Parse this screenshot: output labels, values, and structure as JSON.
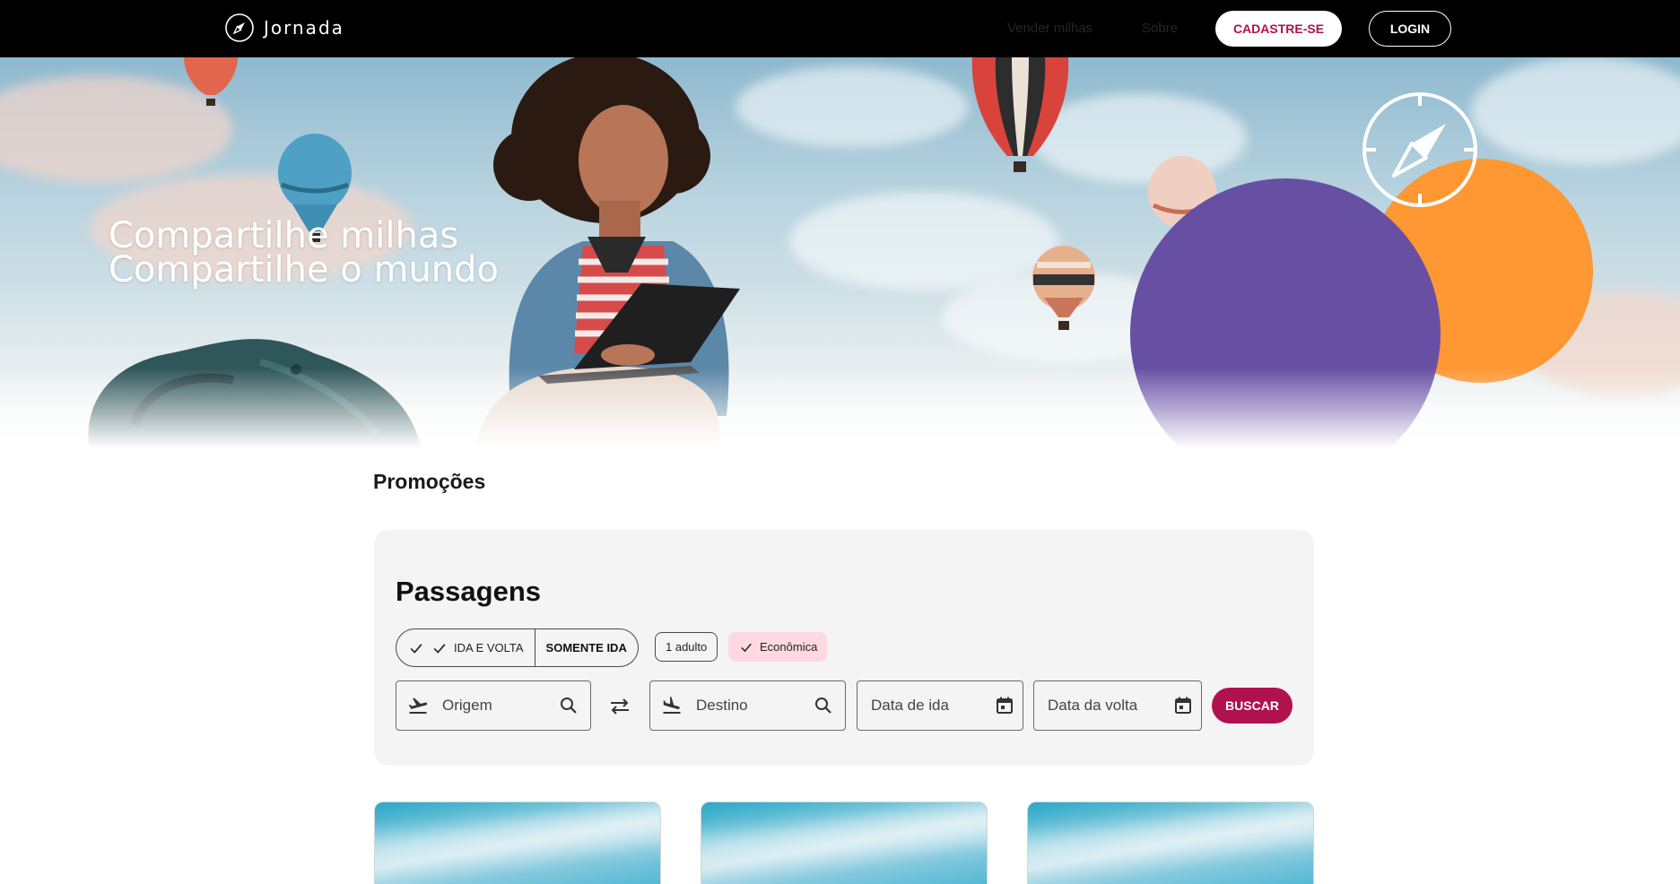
{
  "header": {
    "brand": "Jornada",
    "nav": [
      {
        "label": "Vender milhas"
      },
      {
        "label": "Sobre"
      }
    ],
    "signup_label": "CADASTRE-SE",
    "login_label": "LOGIN"
  },
  "hero": {
    "line1": "Compartilhe milhas",
    "line2": "Compartilhe o mundo"
  },
  "promotions": {
    "title": "Promoções"
  },
  "search": {
    "title": "Passagens",
    "trip_types": [
      {
        "label": "IDA E VOLTA",
        "selected": true
      },
      {
        "label": "SOMENTE IDA",
        "selected": false
      }
    ],
    "passengers_label": "1 adulto",
    "class_label": "Econômica",
    "origin_placeholder": "Origem",
    "destination_placeholder": "Destino",
    "departure_placeholder": "Data de ida",
    "return_placeholder": "Data da volta",
    "search_label": "BUSCAR"
  },
  "colors": {
    "primary": "#b0114f",
    "purple": "#6750a4",
    "orange": "#ff9733",
    "chip_selected": "#ffd9e2",
    "card_bg": "#f4f4f4"
  }
}
